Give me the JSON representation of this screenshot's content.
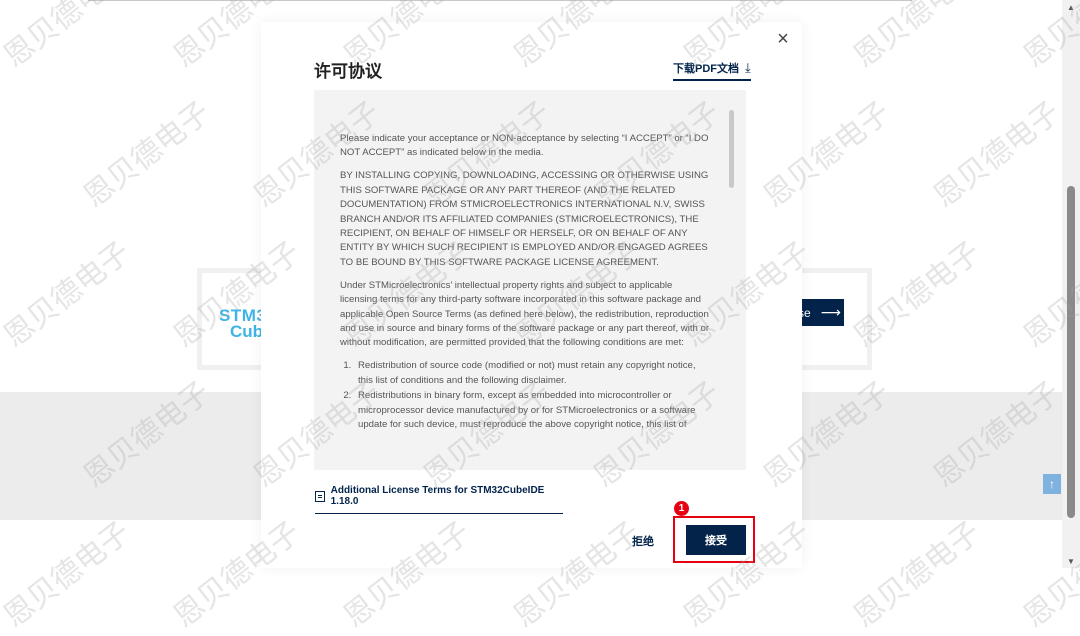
{
  "background": {
    "brand_line1": "STM32",
    "brand_line2": "Cube",
    "button_label": "se",
    "button_arrow": "⟶",
    "scroll_top_icon": "↑"
  },
  "modal": {
    "close_icon": "×",
    "title": "许可协议",
    "pdf_link_label": "下载PDF文档",
    "pdf_download_icon": "⤓",
    "license_paragraphs": [
      "Please indicate your acceptance or NON-acceptance by selecting “I ACCEPT” or “I DO NOT ACCEPT” as indicated below in the media.",
      "BY INSTALLING COPYING, DOWNLOADING, ACCESSING OR OTHERWISE USING THIS SOFTWARE PACKAGE OR ANY PART THEREOF (AND THE RELATED DOCUMENTATION) FROM STMICROELECTRONICS INTERNATIONAL N.V, SWISS BRANCH AND/OR ITS AFFILIATED COMPANIES (STMICROELECTRONICS), THE RECIPIENT, ON BEHALF OF HIMSELF OR HERSELF, OR ON BEHALF OF ANY ENTITY BY WHICH SUCH RECIPIENT IS EMPLOYED AND/OR ENGAGED AGREES TO BE BOUND BY THIS SOFTWARE PACKAGE LICENSE AGREEMENT.",
      "Under STMicroelectronics’ intellectual property rights and subject to applicable licensing terms for any third-party software incorporated in this software package and applicable Open Source Terms (as defined here below), the redistribution, reproduction and use in source and binary forms of the software package or any part thereof, with or without modification, are permitted provided that the following conditions are met:"
    ],
    "license_list": [
      "Redistribution of source code (modified or not) must retain any copyright notice, this list of conditions and the following disclaimer.",
      "Redistributions in binary form, except as embedded into microcontroller or microprocessor device manufactured by or for STMicroelectronics or a software update for such device, must reproduce the above copyright notice, this list of"
    ],
    "additional_terms_label": "Additional License Terms for STM32CubeIDE 1.18.0",
    "reject_label": "拒绝",
    "accept_label": "接受",
    "step_badge": "1"
  },
  "watermark": {
    "text": "恩贝德电子"
  },
  "colors": {
    "navy": "#03234b",
    "highlight_red": "#e60012",
    "brand_cyan": "#3cb4e6"
  }
}
